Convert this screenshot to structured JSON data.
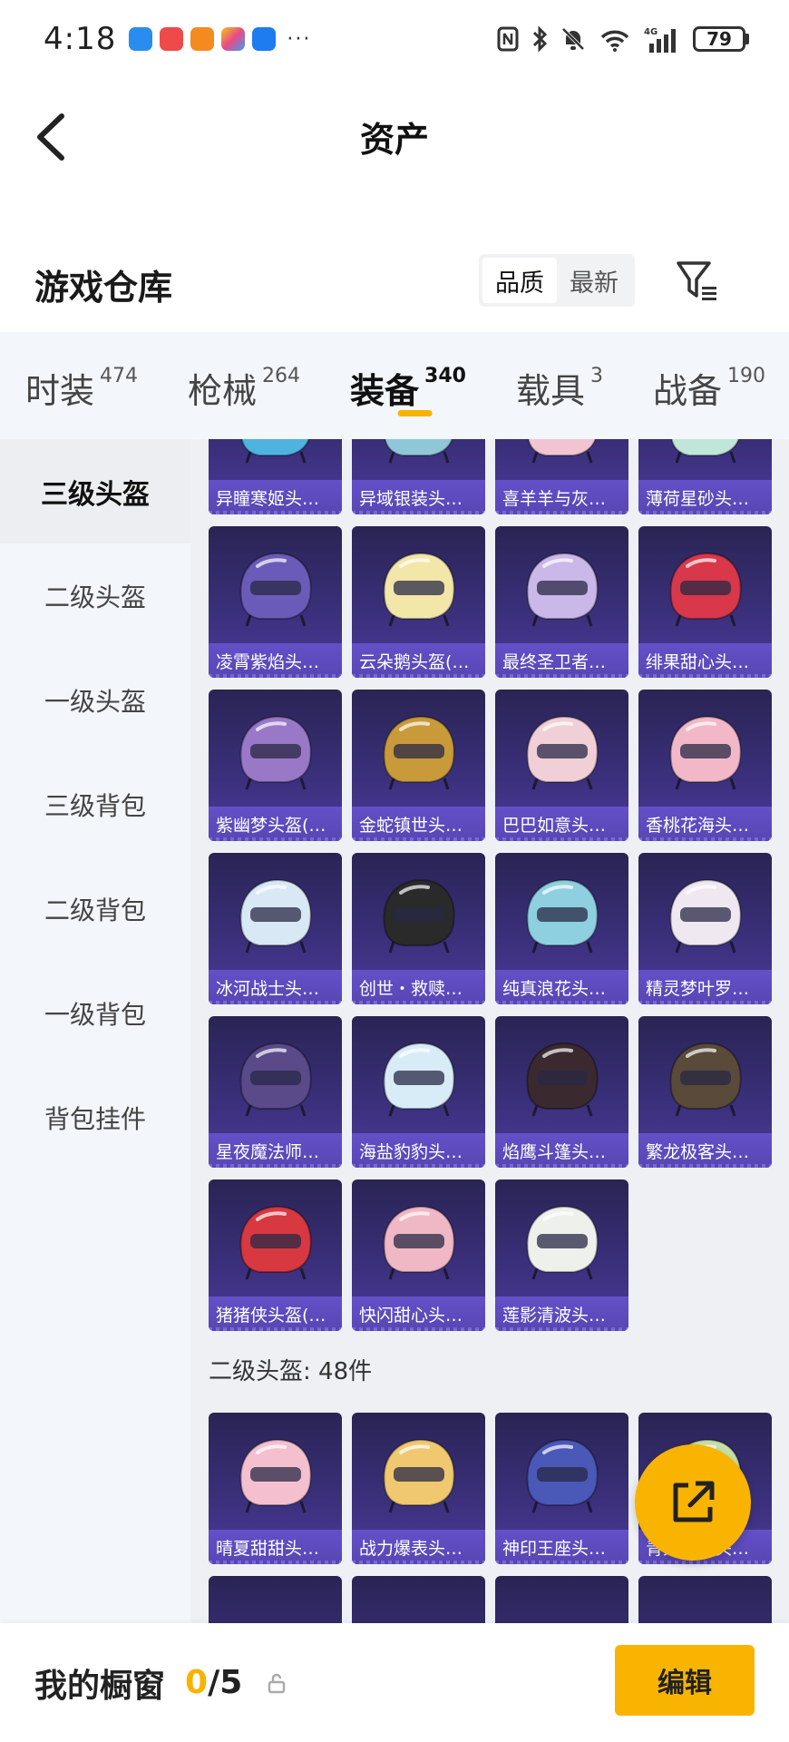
{
  "status_bar": {
    "time": "4:18",
    "battery": "79",
    "notification_icons": [
      "message-app-icon",
      "red-app-icon",
      "video-app-icon",
      "colorful-app-icon",
      "lightbulb-app-icon"
    ],
    "more": "···"
  },
  "header": {
    "title": "资产"
  },
  "warehouse": {
    "title": "游戏仓库",
    "sort_options": [
      "品质",
      "最新"
    ],
    "active_sort": "品质"
  },
  "category_tabs": [
    {
      "label": "时装",
      "count": "474"
    },
    {
      "label": "枪械",
      "count": "264"
    },
    {
      "label": "装备",
      "count": "340"
    },
    {
      "label": "载具",
      "count": "3"
    },
    {
      "label": "战备",
      "count": "190"
    }
  ],
  "active_category": "装备",
  "sidebar": {
    "items": [
      "三级头盔",
      "二级头盔",
      "一级头盔",
      "三级背包",
      "二级背包",
      "一级背包",
      "背包挂件"
    ],
    "active": "三级头盔"
  },
  "grid": {
    "level3_items": [
      {
        "name": "异瞳寒姬头…",
        "color": "#4fb3e0"
      },
      {
        "name": "异域银装头…",
        "color": "#8fc7d8"
      },
      {
        "name": "喜羊羊与灰…",
        "color": "#f2c4d2"
      },
      {
        "name": "薄荷星砂头…",
        "color": "#bfe6d8"
      },
      {
        "name": "凌霄紫焰头…",
        "color": "#6b5bb8"
      },
      {
        "name": "云朵鹅头盔(…",
        "color": "#f2e6a8"
      },
      {
        "name": "最终圣卫者…",
        "color": "#c9b8e8"
      },
      {
        "name": "绯果甜心头…",
        "color": "#d8384a"
      },
      {
        "name": "紫幽梦头盔(…",
        "color": "#9a78c8"
      },
      {
        "name": "金蛇镇世头…",
        "color": "#c89a3a"
      },
      {
        "name": "巴巴如意头…",
        "color": "#f0d0d6"
      },
      {
        "name": "香桃花海头…",
        "color": "#f2b8c8"
      },
      {
        "name": "冰河战士头…",
        "color": "#d8e8f4"
      },
      {
        "name": "创世・救赎…",
        "color": "#2a2a2a"
      },
      {
        "name": "纯真浪花头…",
        "color": "#8ed0e0"
      },
      {
        "name": "精灵梦叶罗…",
        "color": "#f0e8f0"
      },
      {
        "name": "星夜魔法师…",
        "color": "#5a4a8a"
      },
      {
        "name": "海盐豹豹头…",
        "color": "#d8ecf8"
      },
      {
        "name": "焰鹰斗篷头…",
        "color": "#3a2a30"
      },
      {
        "name": "繁龙极客头…",
        "color": "#5a4a3a"
      },
      {
        "name": "猪猪侠头盔(…",
        "color": "#d83840"
      },
      {
        "name": "快闪甜心头…",
        "color": "#f0b8c4"
      },
      {
        "name": "莲影清波头…",
        "color": "#eef0ec"
      }
    ],
    "level2_section": "二级头盔: 48件",
    "level2_items": [
      {
        "name": "晴夏甜甜头…",
        "color": "#f4c0d0"
      },
      {
        "name": "战力爆表头…",
        "color": "#f0c870"
      },
      {
        "name": "神印王座头…",
        "color": "#4a58b8"
      },
      {
        "name": "青梨手账头…",
        "color": "#c8e0a8"
      }
    ]
  },
  "bottom_bar": {
    "label": "我的橱窗",
    "current": "0",
    "total": "/5",
    "edit_label": "编辑"
  },
  "colors": {
    "accent": "#f8b400",
    "card_top": "#2a2454",
    "card_label": "#5846b4"
  }
}
